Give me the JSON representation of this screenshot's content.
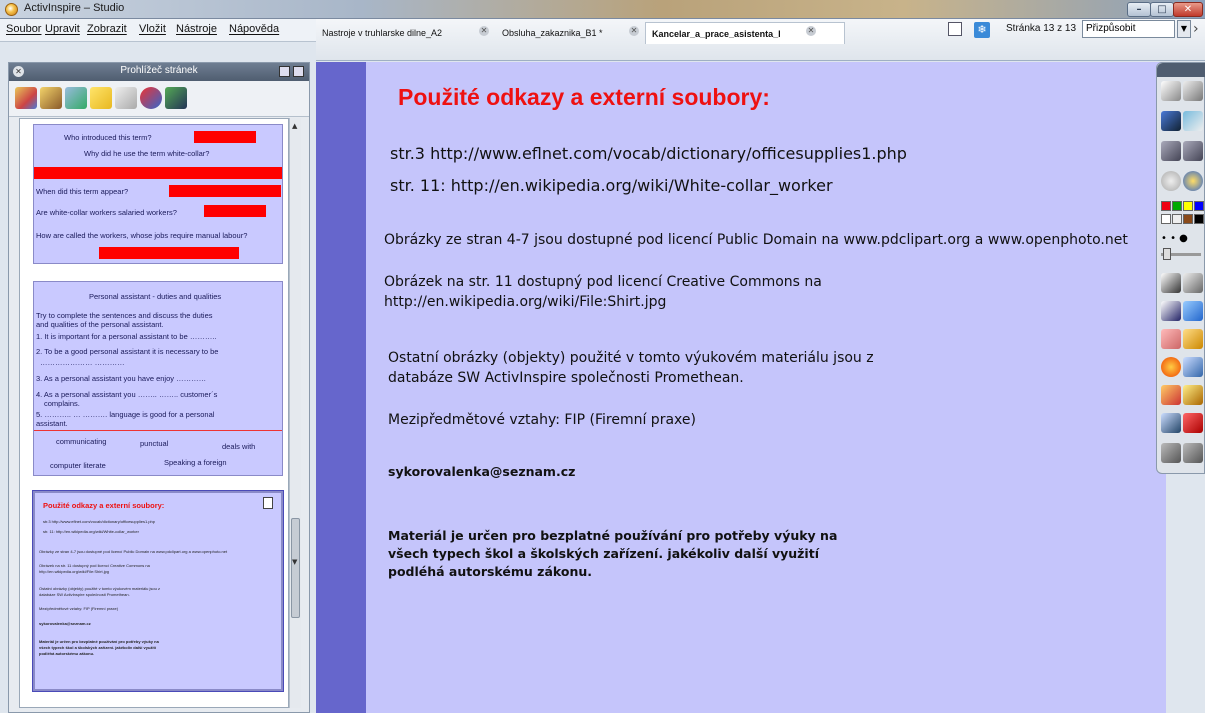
{
  "window": {
    "title": "ActivInspire – Studio"
  },
  "menu": [
    "Soubor",
    "Upravit",
    "Zobrazit",
    "Vložit",
    "Nástroje",
    "Nápověda"
  ],
  "tabs": [
    {
      "label": "Nastroje v truhlarske dilne_A2"
    },
    {
      "label": "Obsluha_zakaznika_B1 *"
    },
    {
      "label": "Kancelar_a_prace_asistenta_l"
    }
  ],
  "page_indicator": "Stránka 13 z 13",
  "zoom": "Přizpůsobit",
  "browser": {
    "title": "Prohlížeč stránek",
    "thumb1": {
      "lines": [
        "Who introduced this term?",
        "Why did he use the term white-collar?",
        "When did this term appear?",
        "Are white-collar workers salaried workers?",
        "How are called the workers, whose jobs require manual labour?"
      ]
    },
    "thumb2": {
      "title": "Personal assistant - duties and qualities",
      "lines": [
        "Try to complete the sentences and discuss the duties",
        "and qualities of the personal assistant.",
        "1. It is important for a personal assistant to be ………..",
        "2. To be a good personal assistant it is necessary to be",
        "………………… …………",
        "3. As a personal assistant you have enjoy …………",
        "4. As a personal assistant you …….. …….. customer´s",
        "complains.",
        "5. ……….. … ………. language is good for a personal",
        "assistant."
      ],
      "words": [
        "communicating",
        "punctual",
        "deals with",
        "computer literate",
        "Speaking a foreign"
      ]
    },
    "thumb3": {
      "title": "Použité odkazy a externí soubory:",
      "lines": [
        "str.3 http://www.eflnet.com/vocab/dictionary/officesupplies1.php",
        "str. 11: http://en.wikipedia.org/wiki/White-collar_worker",
        "Obrázky ze stran 4-7 jsou dostupné pod licencí Public Domain na www.pdclipart.org a www.openphoto.net",
        "Obrázek na str. 11 dostupný pod licencí Creative Commons na",
        "http://en.wikipedia.org/wiki/File:Shirt.jpg",
        "Ostatní obrázky (objekty) použité v tomto výukovém materiálu jsou z",
        "databáze SW ActivInspire společnosti Promethean.",
        "Mezipředmětové vztahy: FIP (Firemní praxe)",
        "sykorovalenka@seznam.cz",
        "Materiál je určen pro bezplatné používání pro potřeby výuky na",
        "všech typech škol a školských zařízení. jakékoliv další využití",
        "podléhá autorskému zákonu."
      ]
    }
  },
  "slide": {
    "title": "Použité odkazy a externí soubory:",
    "ref1": "str.3 http://www.eflnet.com/vocab/dictionary/officesupplies1.php",
    "ref2": "str. 11: http://en.wikipedia.org/wiki/White-collar_worker",
    "license1": "Obrázky ze stran 4-7 jsou dostupné pod licencí Public Domain na www.pdclipart.org a www.openphoto.net",
    "license2_line1": "Obrázek na str. 11 dostupný pod licencí Creative Commons na",
    "license2_line2": "http://en.wikipedia.org/wiki/File:Shirt.jpg",
    "other_line1": "Ostatní obrázky (objekty) použité v tomto výukovém materiálu jsou z",
    "other_line2": "databáze SW ActivInspire společnosti Promethean.",
    "relations": "Mezipředmětové vztahy: FIP (Firemní praxe)",
    "email": "sykorovalenka@seznam.cz",
    "note_line1": "Materiál je určen pro bezplatné používání pro potřeby výuky na",
    "note_line2": "všech typech škol a školských zařízení. jakékoliv další využití",
    "note_line3": "podléhá autorskému zákonu."
  },
  "colors": {
    "slide_bg": "#c5c5fb",
    "slide_frame": "#6666cc",
    "title_red": "#ee1111"
  },
  "toolbox_icons": [
    "page-icon",
    "pen-icon",
    "highlighter-icon",
    "eraser-icon",
    "select-icon",
    "shape-icon",
    "undo-icon",
    "redo-icon"
  ]
}
